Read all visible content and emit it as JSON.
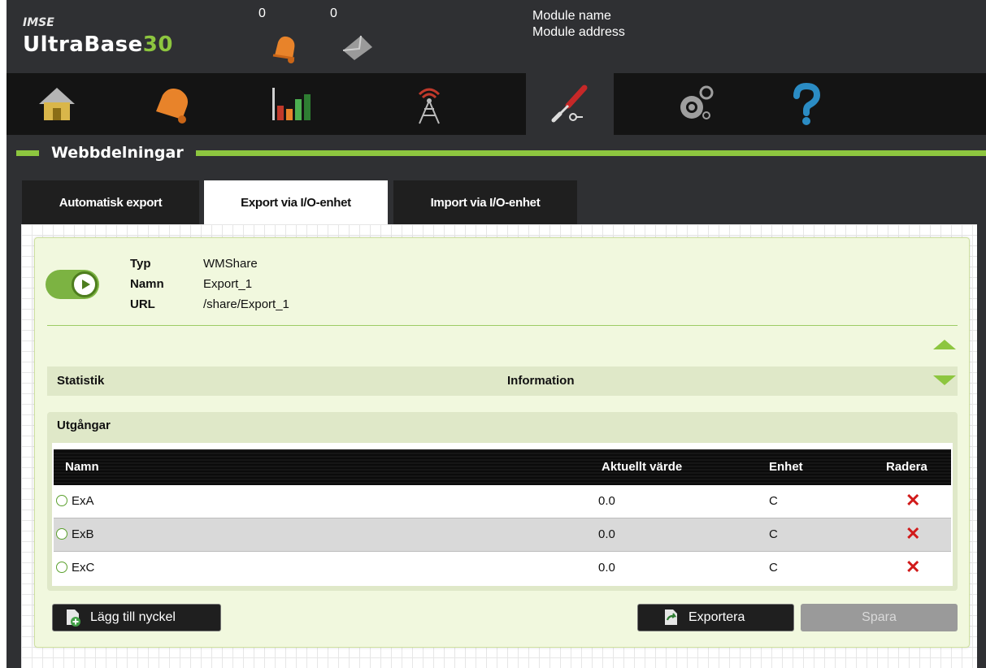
{
  "header": {
    "brand_top": "IMSE",
    "brand_name": "UltraBase",
    "brand_number": "30",
    "alarm_count": "0",
    "message_count": "0",
    "module_name": "Module name",
    "module_address": "Module address"
  },
  "nav": {
    "items": [
      {
        "icon": "home-icon"
      },
      {
        "icon": "alarm-bell-icon"
      },
      {
        "icon": "bar-chart-icon"
      },
      {
        "icon": "antenna-tower-icon"
      },
      {
        "icon": "tools-icon",
        "active": true
      },
      {
        "icon": "settings-gears-icon"
      },
      {
        "icon": "help-icon"
      }
    ]
  },
  "section": {
    "title": "Webbdelningar"
  },
  "tabs": [
    {
      "label": "Automatisk export"
    },
    {
      "label": "Export via I/O-enhet",
      "active": true
    },
    {
      "label": "Import via I/O-enhet"
    }
  ],
  "share": {
    "type_label": "Typ",
    "type_value": "WMShare",
    "name_label": "Namn",
    "name_value": "Export_1",
    "url_label": "URL",
    "url_value": "/share/Export_1"
  },
  "statbar": {
    "left": "Statistik",
    "center": "Information"
  },
  "outputs": {
    "title": "Utgångar",
    "columns": {
      "name": "Namn",
      "value": "Aktuellt värde",
      "unit": "Enhet",
      "delete": "Radera"
    },
    "rows": [
      {
        "name": "ExA",
        "value": "0.0",
        "unit": "C",
        "delete": "✕"
      },
      {
        "name": "ExB",
        "value": "0.0",
        "unit": "C",
        "delete": "✕"
      },
      {
        "name": "ExC",
        "value": "0.0",
        "unit": "C",
        "delete": "✕"
      }
    ]
  },
  "buttons": {
    "add_key": "Lägg till nyckel",
    "export": "Exportera",
    "save": "Spara"
  },
  "colors": {
    "accent": "#8dc63f",
    "dark": "#2f3033",
    "delete": "#d11a1a"
  }
}
